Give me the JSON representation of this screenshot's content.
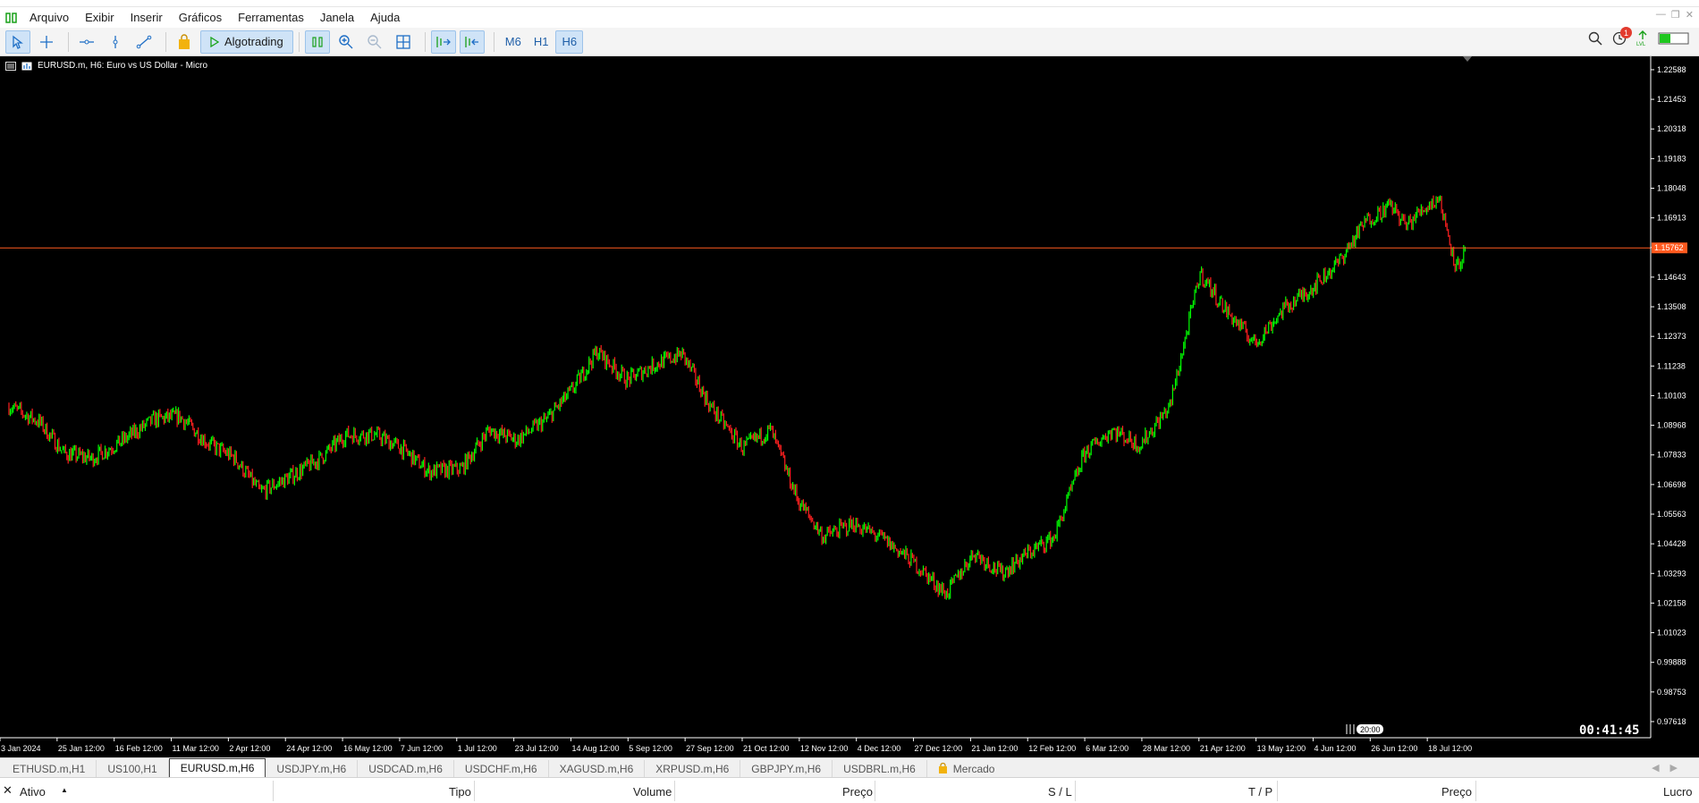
{
  "menu": [
    "Arquivo",
    "Exibir",
    "Inserir",
    "Gráficos",
    "Ferramentas",
    "Janela",
    "Ajuda"
  ],
  "toolbar": {
    "algotrading_label": "Algotrading",
    "timeframes": [
      "M6",
      "H1",
      "H6"
    ],
    "active_timeframe": "H6",
    "notification_count": "1"
  },
  "chart": {
    "header": "EURUSD.m, H6:  Euro vs US Dollar - Micro",
    "countdown": "00:41:45",
    "time_marker": "20:00",
    "current_price": "1.15762"
  },
  "chart_data": {
    "type": "candlestick-line",
    "symbol": "EURUSD.m",
    "timeframe": "H6",
    "yticks": [
      "1.22588",
      "1.21453",
      "1.20318",
      "1.19183",
      "1.18048",
      "1.16913",
      "1.15778",
      "1.14643",
      "1.13508",
      "1.12373",
      "1.11238",
      "1.10103",
      "1.08968",
      "1.07833",
      "1.06698",
      "1.05563",
      "1.04428",
      "1.03293",
      "1.02158",
      "1.01023",
      "0.99888",
      "0.98753",
      "0.97618"
    ],
    "xticks": [
      "3 Jan 2024",
      "25 Jan 12:00",
      "16 Feb 12:00",
      "11 Mar 12:00",
      "2 Apr 12:00",
      "24 Apr 12:00",
      "16 May 12:00",
      "7 Jun 12:00",
      "1 Jul 12:00",
      "23 Jul 12:00",
      "14 Aug 12:00",
      "5 Sep 12:00",
      "27 Sep 12:00",
      "21 Oct 12:00",
      "12 Nov 12:00",
      "4 Dec 12:00",
      "27 Dec 12:00",
      "21 Jan 12:00",
      "12 Feb 12:00",
      "6 Mar 12:00",
      "28 Mar 12:00",
      "21 Apr 12:00",
      "13 May 12:00",
      "4 Jun 12:00",
      "26 Jun 12:00",
      "18 Jul 12:00"
    ],
    "ylim": [
      0.97,
      1.231
    ],
    "up_color": "#00ff00",
    "down_color": "#ff2020",
    "price_line_color": "#ff5a1f",
    "series": [
      {
        "x": "3 Jan 2024",
        "y": 1.097
      },
      {
        "x": "15 Jan 2024",
        "y": 1.091
      },
      {
        "x": "25 Jan 2024",
        "y": 1.079
      },
      {
        "x": "5 Feb 2024",
        "y": 1.077
      },
      {
        "x": "16 Feb 2024",
        "y": 1.083
      },
      {
        "x": "1 Mar 2024",
        "y": 1.092
      },
      {
        "x": "11 Mar 2024",
        "y": 1.093
      },
      {
        "x": "22 Mar 2024",
        "y": 1.083
      },
      {
        "x": "2 Apr 2024",
        "y": 1.077
      },
      {
        "x": "12 Apr 2024",
        "y": 1.064
      },
      {
        "x": "24 Apr 2024",
        "y": 1.07
      },
      {
        "x": "6 May 2024",
        "y": 1.077
      },
      {
        "x": "16 May 2024",
        "y": 1.086
      },
      {
        "x": "28 May 2024",
        "y": 1.086
      },
      {
        "x": "7 Jun 2024",
        "y": 1.081
      },
      {
        "x": "18 Jun 2024",
        "y": 1.072
      },
      {
        "x": "1 Jul 2024",
        "y": 1.073
      },
      {
        "x": "12 Jul 2024",
        "y": 1.088
      },
      {
        "x": "23 Jul 2024",
        "y": 1.084
      },
      {
        "x": "4 Aug 2024",
        "y": 1.092
      },
      {
        "x": "14 Aug 2024",
        "y": 1.103
      },
      {
        "x": "24 Aug 2024",
        "y": 1.118
      },
      {
        "x": "5 Sep 2024",
        "y": 1.107
      },
      {
        "x": "16 Sep 2024",
        "y": 1.113
      },
      {
        "x": "27 Sep 2024",
        "y": 1.117
      },
      {
        "x": "8 Oct 2024",
        "y": 1.097
      },
      {
        "x": "21 Oct 2024",
        "y": 1.081
      },
      {
        "x": "1 Nov 2024",
        "y": 1.088
      },
      {
        "x": "12 Nov 2024",
        "y": 1.061
      },
      {
        "x": "22 Nov 2024",
        "y": 1.047
      },
      {
        "x": "4 Dec 2024",
        "y": 1.052
      },
      {
        "x": "16 Dec 2024",
        "y": 1.046
      },
      {
        "x": "27 Dec 2024",
        "y": 1.038
      },
      {
        "x": "10 Jan 2025",
        "y": 1.025
      },
      {
        "x": "21 Jan 2025",
        "y": 1.041
      },
      {
        "x": "1 Feb 2025",
        "y": 1.033
      },
      {
        "x": "12 Feb 2025",
        "y": 1.041
      },
      {
        "x": "22 Feb 2025",
        "y": 1.047
      },
      {
        "x": "6 Mar 2025",
        "y": 1.079
      },
      {
        "x": "17 Mar 2025",
        "y": 1.088
      },
      {
        "x": "28 Mar 2025",
        "y": 1.082
      },
      {
        "x": "9 Apr 2025",
        "y": 1.097
      },
      {
        "x": "21 Apr 2025",
        "y": 1.148
      },
      {
        "x": "1 May 2025",
        "y": 1.134
      },
      {
        "x": "13 May 2025",
        "y": 1.121
      },
      {
        "x": "24 May 2025",
        "y": 1.134
      },
      {
        "x": "4 Jun 2025",
        "y": 1.142
      },
      {
        "x": "15 Jun 2025",
        "y": 1.152
      },
      {
        "x": "26 Jun 2025",
        "y": 1.168
      },
      {
        "x": "6 Jul 2025",
        "y": 1.174
      },
      {
        "x": "12 Jul 2025",
        "y": 1.166
      },
      {
        "x": "18 Jul 2025",
        "y": 1.172
      },
      {
        "x": "25 Jul 2025",
        "y": 1.177
      },
      {
        "x": "1 Aug 2025",
        "y": 1.15
      },
      {
        "x": "5 Aug 2025",
        "y": 1.157
      }
    ]
  },
  "tabs": [
    {
      "label": "ETHUSD.m,H1",
      "active": false
    },
    {
      "label": "US100,H1",
      "active": false
    },
    {
      "label": "EURUSD.m,H6",
      "active": true
    },
    {
      "label": "USDJPY.m,H6",
      "active": false
    },
    {
      "label": "USDCAD.m,H6",
      "active": false
    },
    {
      "label": "USDCHF.m,H6",
      "active": false
    },
    {
      "label": "XAGUSD.m,H6",
      "active": false
    },
    {
      "label": "XRPUSD.m,H6",
      "active": false
    },
    {
      "label": "GBPJPY.m,H6",
      "active": false
    },
    {
      "label": "USDBRL.m,H6",
      "active": false
    }
  ],
  "market_tab": "Mercado",
  "table": {
    "columns": [
      "Ativo",
      "Tipo",
      "Volume",
      "Preço",
      "S / L",
      "T / P",
      "Preço",
      "Lucro"
    ]
  },
  "icons": {
    "app": "trading-app-icon",
    "cursor": "cursor-icon",
    "crosshair": "crosshair-icon",
    "hline": "horizontal-line-icon",
    "vline": "vertical-line-icon",
    "trend": "trendline-icon",
    "shop": "market-bag-icon",
    "chart-type": "candles-icon",
    "zoom-in": "zoom-in-icon",
    "zoom-out": "zoom-out-icon",
    "grid": "grid-icon",
    "autoscroll": "autoscroll-icon",
    "shift": "chart-shift-icon",
    "search": "search-icon",
    "alerts": "notification-icon",
    "signal": "signal-icon",
    "battery": "connection-bar-icon"
  }
}
